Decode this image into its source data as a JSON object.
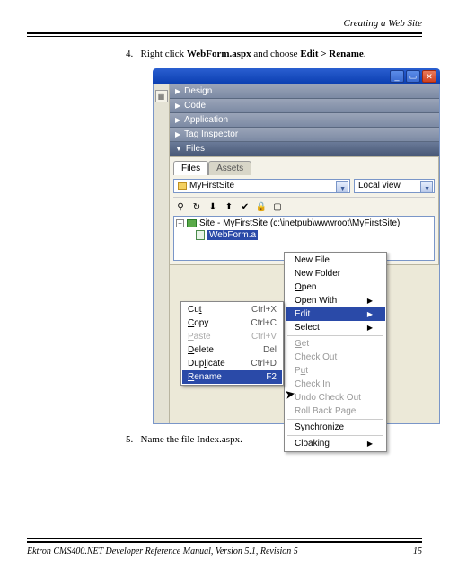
{
  "header": {
    "title": "Creating a Web Site"
  },
  "steps": {
    "s4_num": "4.",
    "s4_a": "Right click ",
    "s4_b": "WebForm.aspx",
    "s4_c": " and choose ",
    "s4_d": "Edit > Rename",
    "s4_e": ".",
    "s5_num": "5.",
    "s5": "Name the file Index.aspx."
  },
  "panels": {
    "design": "Design",
    "code": "Code",
    "application": "Application",
    "tag_inspector": "Tag Inspector",
    "files": "Files"
  },
  "tabs": {
    "files": "Files",
    "assets": "Assets"
  },
  "dropdowns": {
    "site": "MyFirstSite",
    "view": "Local view"
  },
  "tree": {
    "root": "Site - MyFirstSite (c:\\inetpub\\wwwroot\\MyFirstSite)",
    "file": "WebForm.a"
  },
  "context": {
    "new_file": "New File",
    "new_folder": "New Folder",
    "open": "Open",
    "open_with": "Open With",
    "edit": "Edit",
    "select": "Select",
    "get": "Get",
    "check_out": "Check Out",
    "put": "Put",
    "check_in": "Check In",
    "undo_check_out": "Undo Check Out",
    "roll_back_page": "Roll Back Page",
    "synchronize": "Synchronize",
    "cloaking": "Cloaking"
  },
  "edit_menu": [
    {
      "label": "Cut",
      "u": "t",
      "shortcut": "Ctrl+X",
      "enabled": true
    },
    {
      "label": "Copy",
      "u": "C",
      "shortcut": "Ctrl+C",
      "enabled": true
    },
    {
      "label": "Paste",
      "u": "P",
      "shortcut": "Ctrl+V",
      "enabled": false
    },
    {
      "label": "Delete",
      "u": "D",
      "shortcut": "Del",
      "enabled": true
    },
    {
      "label": "Duplicate",
      "u": "l",
      "shortcut": "Ctrl+D",
      "enabled": true
    },
    {
      "label": "Rename",
      "u": "R",
      "shortcut": "F2",
      "enabled": true,
      "selected": true
    }
  ],
  "footer": {
    "text": "Ektron CMS400.NET Developer Reference Manual, Version 5.1, Revision 5",
    "page": "15"
  }
}
